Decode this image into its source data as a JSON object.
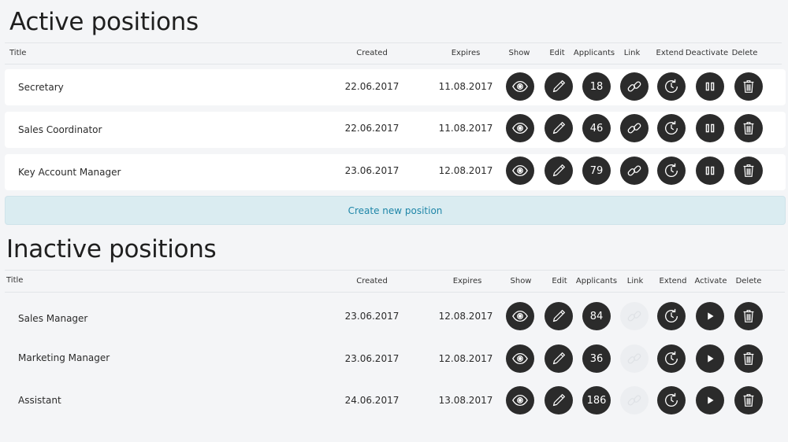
{
  "active": {
    "title": "Active positions",
    "headers": {
      "title": "Title",
      "created": "Created",
      "expires": "Expires",
      "show": "Show",
      "edit": "Edit",
      "applicants": "Applicants",
      "link": "Link",
      "extend": "Extend",
      "toggle": "Deactivate",
      "delete": "Delete"
    },
    "rows": [
      {
        "title": "Secretary",
        "created": "22.06.2017",
        "expires": "11.08.2017",
        "applicants": "18"
      },
      {
        "title": "Sales Coordinator",
        "created": "22.06.2017",
        "expires": "11.08.2017",
        "applicants": "46"
      },
      {
        "title": "Key Account Manager",
        "created": "23.06.2017",
        "expires": "12.08.2017",
        "applicants": "79"
      }
    ],
    "create_label": "Create new position"
  },
  "inactive": {
    "title": "Inactive positions",
    "headers": {
      "title": "Title",
      "created": "Created",
      "expires": "Expires",
      "show": "Show",
      "edit": "Edit",
      "applicants": "Applicants",
      "link": "Link",
      "extend": "Extend",
      "toggle": "Activate",
      "delete": "Delete"
    },
    "rows": [
      {
        "title": "Sales Manager",
        "created": "23.06.2017",
        "expires": "12.08.2017",
        "applicants": "84"
      },
      {
        "title": "Marketing Manager",
        "created": "23.06.2017",
        "expires": "12.08.2017",
        "applicants": "36"
      },
      {
        "title": "Assistant",
        "created": "24.06.2017",
        "expires": "13.08.2017",
        "applicants": "186"
      }
    ]
  },
  "icons": {
    "show": "eye-icon",
    "edit": "pencil-icon",
    "link": "link-icon",
    "extend": "clock-refresh-icon",
    "deactivate": "pause-icon",
    "activate": "play-icon",
    "delete": "trash-icon"
  },
  "colors": {
    "button": "#2b2b2b",
    "row": "#ffffff",
    "background": "#f4f5f7",
    "create_bg": "#daecf1",
    "create_text": "#1f86a8",
    "disabled": "#eceef1"
  }
}
